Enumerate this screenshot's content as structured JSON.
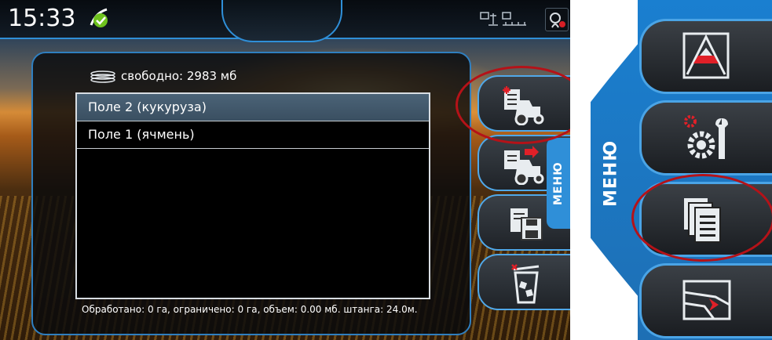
{
  "status_bar": {
    "time": "15:33",
    "gps_icon": "satellite-signal-icon",
    "status_icon": "sections-status-icon",
    "button_icon": "user-profile-icon"
  },
  "storage": {
    "icon": "storage-disk-icon",
    "label": "свободно: 2983 мб"
  },
  "field_list": {
    "items": [
      {
        "label": "Поле 2 (кукуруза)",
        "selected": true
      },
      {
        "label": "Поле 1 (ячмень)",
        "selected": false
      }
    ]
  },
  "status_line": "Обработано: 0 га, ограничено: 0 га, объем: 0.00 мб. штанга: 24.0м.",
  "side_menu": {
    "tab_label": "МЕНЮ",
    "buttons": [
      {
        "icon": "new-field-tractor-icon",
        "highlighted": true
      },
      {
        "icon": "load-field-tractor-icon",
        "highlighted": false
      },
      {
        "icon": "save-field-icon",
        "highlighted": false
      },
      {
        "icon": "delete-field-icon",
        "highlighted": false
      }
    ]
  },
  "zoom_menu": {
    "label": "МЕНЮ",
    "buttons": [
      {
        "icon": "guidance-view-icon",
        "highlighted": false
      },
      {
        "icon": "settings-tools-icon",
        "highlighted": false
      },
      {
        "icon": "field-documents-icon",
        "highlighted": true
      },
      {
        "icon": "boundary-navigation-icon",
        "highlighted": false
      }
    ]
  },
  "colors": {
    "accent_blue": "#2f8fd8",
    "highlight_red": "#b51218",
    "gps_green": "#6ec21d"
  }
}
